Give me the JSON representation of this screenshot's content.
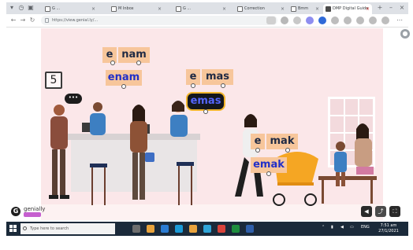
{
  "browser": {
    "tabs": [
      {
        "label": "G ...",
        "active": false
      },
      {
        "label": "M Inbox",
        "active": false
      },
      {
        "label": "G ...",
        "active": false
      },
      {
        "label": "Correction",
        "active": false
      },
      {
        "label": "Bmm",
        "active": false
      },
      {
        "label": "DMP Digital Guide",
        "active": true
      }
    ],
    "url": "https://view.genial.ly/...",
    "colors": {
      "tabbar": "#dee1e6",
      "active_tab": "#ffffff"
    }
  },
  "slide": {
    "number": "5",
    "words": {
      "w1_prefix": "e",
      "w1_root": "nam",
      "w1_full": "enam",
      "w2_prefix": "e",
      "w2_root": "mas",
      "w2_full": "emas",
      "w3_prefix": "e",
      "w3_root": "mak",
      "w3_full": "emak"
    },
    "speech_bubble": "•••",
    "colors": {
      "background": "#fbe7e9",
      "syllable_box": "#f7c69b",
      "word_blue": "#2230c8",
      "selection_border": "#f2b52b"
    }
  },
  "genially": {
    "logo_letter": "G",
    "brand": "genially"
  },
  "taskbar": {
    "search_placeholder": "Type here to search",
    "time": "7:51 am",
    "date": "27/1/2021",
    "lang": "ENG"
  }
}
